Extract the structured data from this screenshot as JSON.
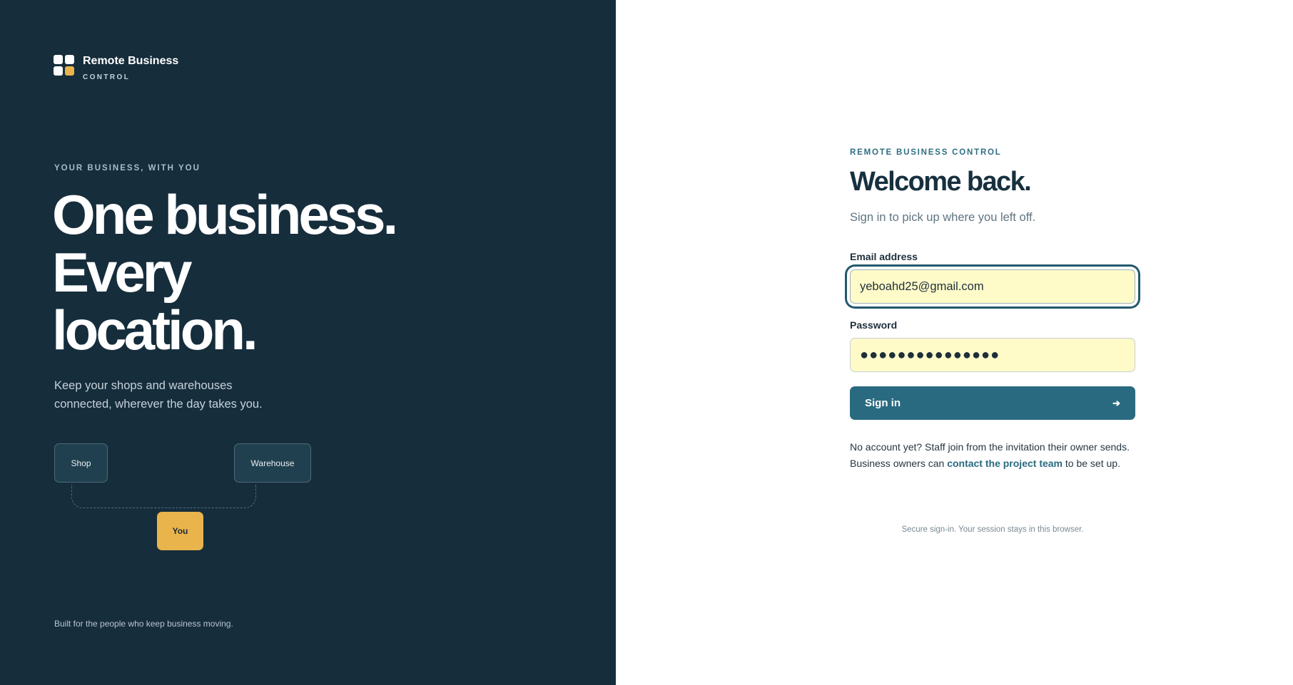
{
  "brand": {
    "name": "Remote Business",
    "subname": "CONTROL"
  },
  "left": {
    "eyebrow": "YOUR BUSINESS, WITH YOU",
    "hero_lines": [
      "One business.",
      "Every",
      "location."
    ],
    "lead": "Keep your shops and warehouses connected, wherever the day takes you.",
    "diagram": {
      "shop": "Shop",
      "warehouse": "Warehouse",
      "you": "You"
    },
    "footer": "Built for the people who keep business moving."
  },
  "form": {
    "eyebrow": "REMOTE BUSINESS CONTROL",
    "title": "Welcome back.",
    "subtitle": "Sign in to pick up where you left off.",
    "email": {
      "label": "Email address",
      "value": "yeboahd25@gmail.com"
    },
    "password": {
      "label": "Password",
      "value": "●●●●●●●●●●●●●●●"
    },
    "submit_label": "Sign in",
    "help_prefix": "No account yet? Staff join from the invitation their owner sends. Business owners can ",
    "help_link": "contact the project team",
    "help_suffix": " to be set up.",
    "secure_note": "Secure sign-in. Your session stays in this browser."
  },
  "colors": {
    "left_background": "#162d3c",
    "accent": "#2a6a80",
    "gold": "#e9b44c",
    "autofill": "#fffbc9"
  },
  "icons": {
    "brand_logo": "brand-logo-icon",
    "submit_arrow": "arrow-right-icon"
  }
}
